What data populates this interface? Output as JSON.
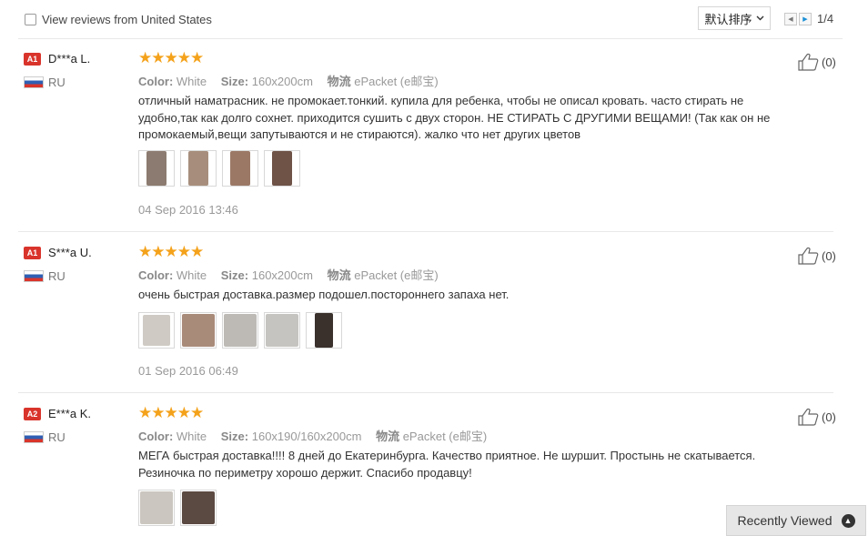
{
  "filter": {
    "label": "View reviews from United States",
    "checked": false
  },
  "sort": {
    "selected": "默认排序"
  },
  "pagination": {
    "current": "1/4"
  },
  "reviews": [
    {
      "badge": "A1",
      "name": "D***a L.",
      "country": "RU",
      "rating": "★★★★★",
      "color_label": "Color:",
      "color_value": "White",
      "size_label": "Size:",
      "size_value": "160x200cm",
      "shipping_label": "物流",
      "shipping_value": "ePacket (e邮宝)",
      "text": "отличный наматрасник. не промокает.тонкий. купила для ребенка, чтобы не описал кровать. часто стирать не удобно,так как долго сохнет. приходится сушить с двух сторон. НЕ СТИРАТЬ С ДРУГИМИ ВЕЩАМИ! (Так как он не промокаемый,вещи запутываются и не стираются). жалко что нет других цветов",
      "likes": "(0)",
      "date": "04 Sep 2016 13:46",
      "photos": [
        "#8c7b70",
        "#a78e7c",
        "#9b7866",
        "#6f5347"
      ]
    },
    {
      "badge": "A1",
      "name": "S***a U.",
      "country": "RU",
      "rating": "★★★★★",
      "color_label": "Color:",
      "color_value": "White",
      "size_label": "Size:",
      "size_value": "160x200cm",
      "shipping_label": "物流",
      "shipping_value": "ePacket (e邮宝)",
      "text": "очень быстрая доставка.размер подошел.постороннего запаха нет.",
      "likes": "(0)",
      "date": "01 Sep 2016 06:49",
      "photos": [
        "#cfcac4",
        "#a98b7a",
        "#bdbab5",
        "#c6c4c1",
        "#3a302c"
      ]
    },
    {
      "badge": "A2",
      "name": "E***a K.",
      "country": "RU",
      "rating": "★★★★★",
      "color_label": "Color:",
      "color_value": "White",
      "size_label": "Size:",
      "size_value": "160x190/160x200cm",
      "shipping_label": "物流",
      "shipping_value": "ePacket (e邮宝)",
      "text": "МЕГА быстрая доставка!!!! 8 дней до Екатеринбурга. Качество приятное. Не шуршит. Простынь не скатывается. Резиночка по периметру хорошо держит. Спасибо продавцу!",
      "likes": "(0)",
      "photos": [
        "#cbc6bf",
        "#5b4a42"
      ]
    }
  ],
  "recently_viewed": {
    "label": "Recently Viewed"
  }
}
